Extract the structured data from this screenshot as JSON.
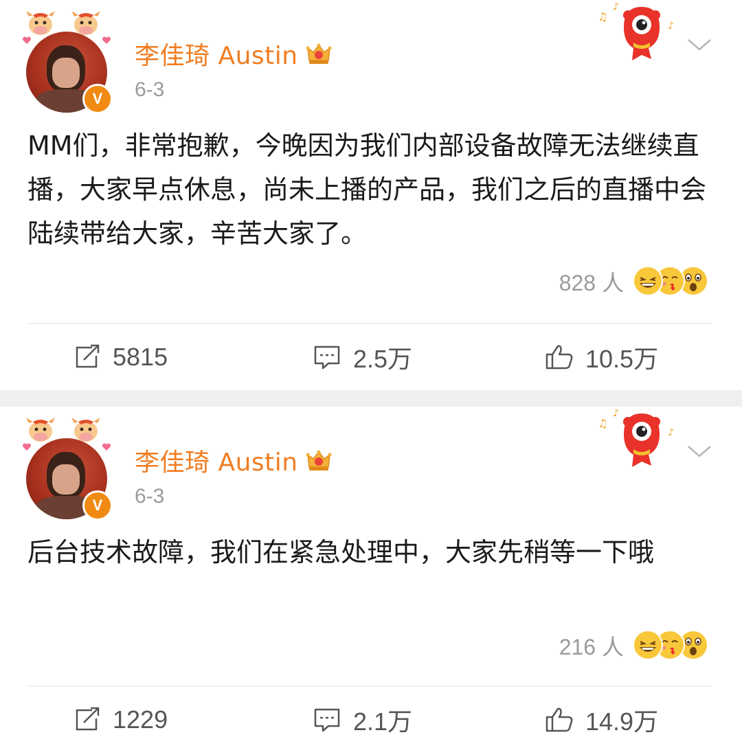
{
  "posts": [
    {
      "author": "李佳琦 Austin",
      "date": "6-3",
      "text": "MM们，非常抱歉，今晚因为我们内部设备故障无法继续直播，大家早点休息，尚未上播的产品，我们之后的直播中会陆续带给大家，辛苦大家了。",
      "reaction_count": "828 人",
      "repost_count": "5815",
      "comment_count": "2.5万",
      "like_count": "10.5万"
    },
    {
      "author": "李佳琦 Austin",
      "date": "6-3",
      "text": "后台技术故障，我们在紧急处理中，大家先稍等一下哦",
      "reaction_count": "216 人",
      "repost_count": "1229",
      "comment_count": "2.1万",
      "like_count": "14.9万"
    }
  ],
  "icons": {
    "avatar_decoration": "ox-icon",
    "verified_badge": "verified-v-icon",
    "member_badge": "crown-icon",
    "mascot": "mascot-icon",
    "menu": "chevron-down-icon",
    "reactions": [
      "laugh-emoji-icon",
      "kiss-emoji-icon",
      "surprise-emoji-icon"
    ],
    "repost": "repost-icon",
    "comment": "comment-icon",
    "like": "thumbs-up-icon"
  },
  "colors": {
    "username": "#f07d22",
    "secondary_text": "#9a9a9a",
    "body_text": "#1a1a1a",
    "verified": "#f08a13",
    "separator": "#efefef"
  }
}
